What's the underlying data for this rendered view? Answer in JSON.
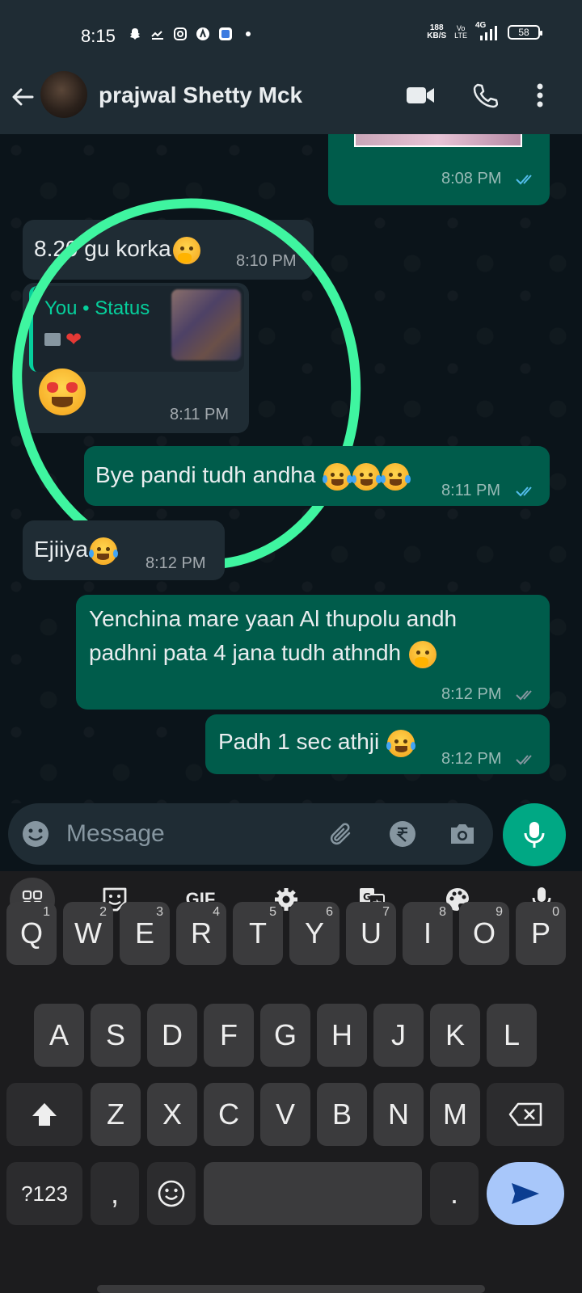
{
  "status_bar": {
    "time": "8:15",
    "net_speed_value": "188",
    "net_speed_unit": "KB/S",
    "volte_top": "Vo",
    "volte_bottom": "LTE",
    "network": "4G",
    "battery": "58",
    "app_icons": [
      "snapchat-icon",
      "missed-call-icon",
      "instagram-icon",
      "app-icon",
      "app-icon-blue",
      "more-dot-icon"
    ]
  },
  "header": {
    "contact_name": "prajwal Shetty Mck",
    "icons": [
      "back-arrow-icon",
      "video-call-icon",
      "voice-call-icon",
      "more-options-icon"
    ]
  },
  "messages": [
    {
      "direction": "out",
      "type": "image",
      "time": "8:08 PM",
      "status": "read"
    },
    {
      "direction": "in",
      "text": "8.20 gu korka",
      "emoji": "hand-over-mouth",
      "time": "8:10 PM"
    },
    {
      "direction": "in",
      "type": "status-reply",
      "reply_author": "You • Status",
      "reply_content": [
        "photo-icon",
        "heart"
      ],
      "emoji": "heart-eyes",
      "time": "8:11 PM"
    },
    {
      "direction": "out",
      "text": "Bye pandi tudh andha",
      "emoji": "tears-of-joy x3",
      "time": "8:11 PM",
      "status": "read"
    },
    {
      "direction": "in",
      "text": "Ejiiya",
      "emoji": "tears-of-joy",
      "time": "8:12 PM"
    },
    {
      "direction": "out",
      "text_line1": "Yenchina mare yaan Al thupolu andh",
      "text_line2": "padhni pata 4 jana tudh athndh",
      "emoji": "hand-over-mouth",
      "time": "8:12 PM",
      "status": "delivered"
    },
    {
      "direction": "out",
      "text": "Padh 1 sec athji",
      "emoji": "tears-of-joy",
      "time": "8:12 PM",
      "status": "delivered"
    }
  ],
  "composer": {
    "placeholder": "Message",
    "icons": [
      "emoji-icon",
      "attach-icon",
      "rupee-payment-icon",
      "camera-icon",
      "mic-icon"
    ]
  },
  "keyboard": {
    "toolbar": [
      "apps-grid-icon",
      "sticker-icon",
      "GIF",
      "settings-icon",
      "translate-icon",
      "theme-palette-icon",
      "voice-input-icon"
    ],
    "gif_label": "GIF",
    "row1": [
      "Q",
      "W",
      "E",
      "R",
      "T",
      "Y",
      "U",
      "I",
      "O",
      "P"
    ],
    "row1_numbers": [
      "1",
      "2",
      "3",
      "4",
      "5",
      "6",
      "7",
      "8",
      "9",
      "0"
    ],
    "row2": [
      "A",
      "S",
      "D",
      "F",
      "G",
      "H",
      "J",
      "K",
      "L"
    ],
    "row3": [
      "Z",
      "X",
      "C",
      "V",
      "B",
      "N",
      "M"
    ],
    "row4": {
      "symbols": "?123",
      "comma": ",",
      "period": "."
    },
    "colors": {
      "key_bg": "#3b3b3d",
      "send_bg": "#a8c7fa"
    }
  },
  "colors": {
    "accent": "#00a884",
    "outgoing_bubble": "#005c4b",
    "incoming_bubble": "#1f2c34",
    "highlight_circle": "#3ff5a0",
    "read_tick": "#53bdeb"
  }
}
